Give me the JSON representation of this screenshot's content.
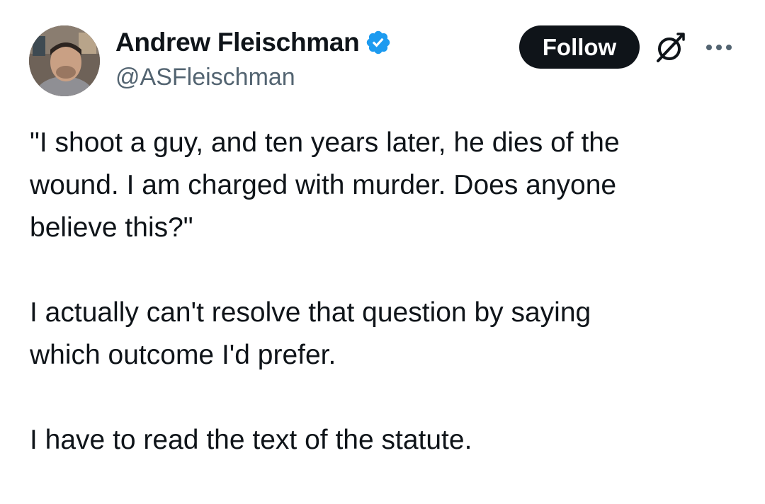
{
  "author": {
    "display_name": "Andrew Fleischman",
    "handle": "@ASFleischman",
    "verified": true,
    "verified_color": "#1d9bf0"
  },
  "actions": {
    "follow_label": "Follow",
    "grok_icon": "grok-icon",
    "more_icon": "more-icon"
  },
  "tweet": {
    "paragraphs": [
      {
        "lines": [
          "\"I shoot a guy, and ten years later, he dies of the",
          "wound. I am charged with murder. Does anyone",
          "believe this?\""
        ]
      },
      {
        "lines": [
          "I actually can't resolve that question by saying",
          "which outcome I'd prefer."
        ]
      },
      {
        "lines": [
          "I have to read the text of the statute."
        ]
      }
    ]
  }
}
